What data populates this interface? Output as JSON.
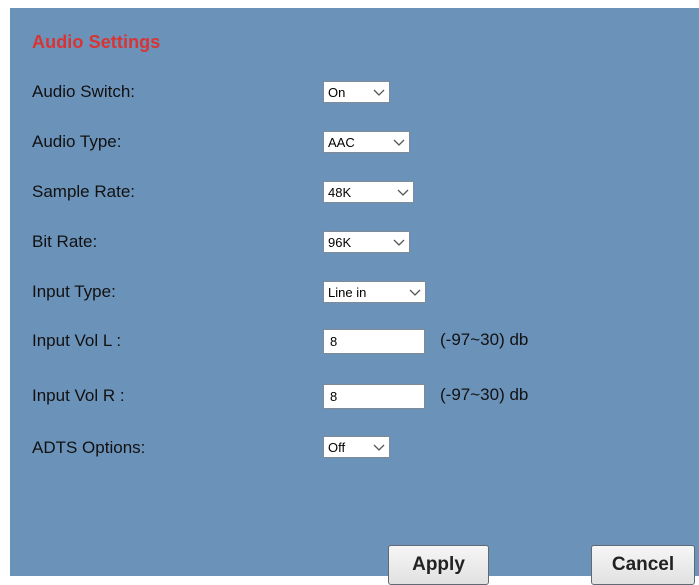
{
  "title": "Audio Settings",
  "fields": {
    "audio_switch": {
      "label": "Audio Switch:",
      "value": "On"
    },
    "audio_type": {
      "label": "Audio Type:",
      "value": "AAC"
    },
    "sample_rate": {
      "label": "Sample Rate:",
      "value": "48K"
    },
    "bit_rate": {
      "label": "Bit Rate:",
      "value": "96K"
    },
    "input_type": {
      "label": "Input Type:",
      "value": "Line in"
    },
    "input_vol_l": {
      "label": "Input Vol L :",
      "value": "8",
      "range": "(-97~30) db"
    },
    "input_vol_r": {
      "label": "Input Vol R :",
      "value": "8",
      "range": "(-97~30) db"
    },
    "adts_options": {
      "label": "ADTS Options:",
      "value": "Off"
    }
  },
  "buttons": {
    "apply": "Apply",
    "cancel": "Cancel"
  },
  "colors": {
    "panel_bg": "#6b92b9",
    "title": "#d93434"
  },
  "icons": {
    "dropdown": "chevron-down-icon"
  }
}
